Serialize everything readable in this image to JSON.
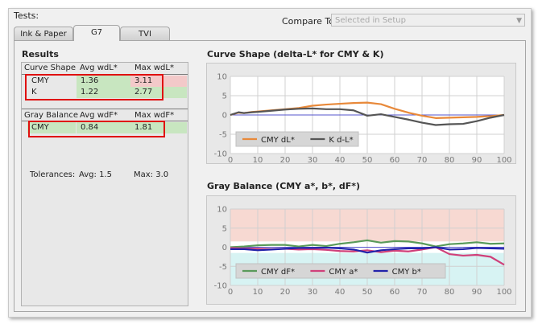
{
  "header": {
    "tests_label": "Tests:",
    "compare_label": "Compare To:",
    "compare_value": "Selected in Setup"
  },
  "tabs": [
    {
      "label": "Ink & Paper",
      "active": false
    },
    {
      "label": "G7",
      "active": true
    },
    {
      "label": "TVI",
      "active": false
    }
  ],
  "results": {
    "title": "Results",
    "curve_shape": {
      "headers": [
        "Curve Shape",
        "Avg wdL*",
        "Max wdL*"
      ],
      "rows": [
        {
          "label": "CMY",
          "avg": "1.36",
          "max": "3.11"
        },
        {
          "label": "K",
          "avg": "1.22",
          "max": "2.77"
        }
      ]
    },
    "gray_balance": {
      "headers": [
        "Gray Balance",
        "Avg wdF*",
        "Max wdF*"
      ],
      "rows": [
        {
          "label": "CMY",
          "avg": "0.84",
          "max": "1.81"
        }
      ]
    },
    "tolerances": {
      "label": "Tolerances:",
      "avg": "Avg: 1.5",
      "max": "Max: 3.0"
    },
    "colors": {
      "pass": "#c8e6c0",
      "fail": "#f3c9c9",
      "highlight": "#e01010"
    }
  },
  "chart_data": [
    {
      "type": "line",
      "title": "Curve Shape (delta-L* for CMY & K)",
      "xlim": [
        0,
        100
      ],
      "ylim": [
        -10,
        10
      ],
      "xticks": [
        "0",
        "10",
        "20",
        "30",
        "40",
        "50",
        "60",
        "70",
        "80",
        "90",
        "100"
      ],
      "yticks": [
        "10",
        "5",
        "0",
        "-5",
        "-10"
      ],
      "series": [
        {
          "name": "CMY dL*",
          "color": "#e8893a",
          "x": [
            0,
            3,
            5,
            8,
            10,
            15,
            20,
            25,
            30,
            35,
            40,
            45,
            50,
            55,
            60,
            65,
            70,
            75,
            80,
            85,
            90,
            95,
            100
          ],
          "y": [
            0,
            0.6,
            0.5,
            0.8,
            0.9,
            1.2,
            1.5,
            1.8,
            2.4,
            2.7,
            2.9,
            3.1,
            3.2,
            2.8,
            1.6,
            0.6,
            -0.2,
            -0.8,
            -0.7,
            -0.6,
            -0.5,
            -0.3,
            0
          ]
        },
        {
          "name": "K d-L*",
          "color": "#555555",
          "x": [
            0,
            3,
            5,
            8,
            10,
            15,
            20,
            25,
            30,
            35,
            40,
            45,
            50,
            55,
            60,
            65,
            70,
            75,
            80,
            85,
            90,
            95,
            100
          ],
          "y": [
            0,
            0.7,
            0.5,
            0.7,
            0.8,
            1.1,
            1.4,
            1.6,
            1.7,
            1.5,
            1.5,
            1.2,
            -0.2,
            0.2,
            -0.5,
            -1.2,
            -2.0,
            -2.6,
            -2.4,
            -2.3,
            -1.6,
            -0.7,
            0
          ]
        }
      ]
    },
    {
      "type": "line",
      "title": "Gray Balance (CMY a*, b*, dF*)",
      "xlim": [
        0,
        100
      ],
      "ylim": [
        -10,
        10
      ],
      "xticks": [
        "0",
        "10",
        "20",
        "30",
        "40",
        "50",
        "60",
        "70",
        "80",
        "90",
        "100"
      ],
      "yticks": [
        "10",
        "5",
        "0",
        "-5",
        "-10"
      ],
      "series": [
        {
          "name": "CMY dF*",
          "color": "#5a9a5a",
          "x": [
            0,
            5,
            10,
            15,
            20,
            25,
            30,
            35,
            40,
            45,
            50,
            55,
            60,
            65,
            70,
            75,
            80,
            85,
            90,
            95,
            100
          ],
          "y": [
            0,
            0.2,
            0.5,
            0.6,
            0.6,
            0.2,
            0.6,
            0.3,
            0.9,
            1.3,
            1.8,
            1.2,
            1.6,
            1.5,
            1.0,
            0.2,
            0.8,
            1.0,
            1.3,
            0.9,
            1.0
          ]
        },
        {
          "name": "CMY a*",
          "color": "#d0407a",
          "x": [
            0,
            5,
            10,
            15,
            20,
            25,
            30,
            35,
            40,
            45,
            50,
            55,
            60,
            65,
            70,
            75,
            80,
            85,
            90,
            95,
            100
          ],
          "y": [
            -0.2,
            -0.3,
            -0.4,
            -0.5,
            -0.4,
            -0.6,
            -0.5,
            -0.7,
            -1.0,
            -1.1,
            -0.8,
            -1.3,
            -0.9,
            -1.1,
            -0.6,
            0,
            -1.8,
            -2.2,
            -2.0,
            -2.5,
            -4.6
          ]
        },
        {
          "name": "CMY b*",
          "color": "#2222aa",
          "x": [
            0,
            5,
            10,
            15,
            20,
            25,
            30,
            35,
            40,
            45,
            50,
            55,
            60,
            65,
            70,
            75,
            80,
            85,
            90,
            95,
            100
          ],
          "y": [
            -0.5,
            -0.5,
            -0.8,
            -0.6,
            -0.4,
            -0.2,
            -0.2,
            -0.1,
            -0.3,
            -0.6,
            -1.4,
            -0.8,
            -0.5,
            -0.3,
            -0.3,
            0,
            -0.6,
            -0.5,
            -0.2,
            -0.3,
            -0.4
          ]
        }
      ],
      "bands": [
        {
          "from": 1.5,
          "to": 10,
          "color": "#f7d9d2"
        },
        {
          "from": -1.5,
          "to": 1.5,
          "color": "#ffffff"
        },
        {
          "from": -10,
          "to": -1.5,
          "color": "#d7f3f3"
        }
      ]
    }
  ]
}
